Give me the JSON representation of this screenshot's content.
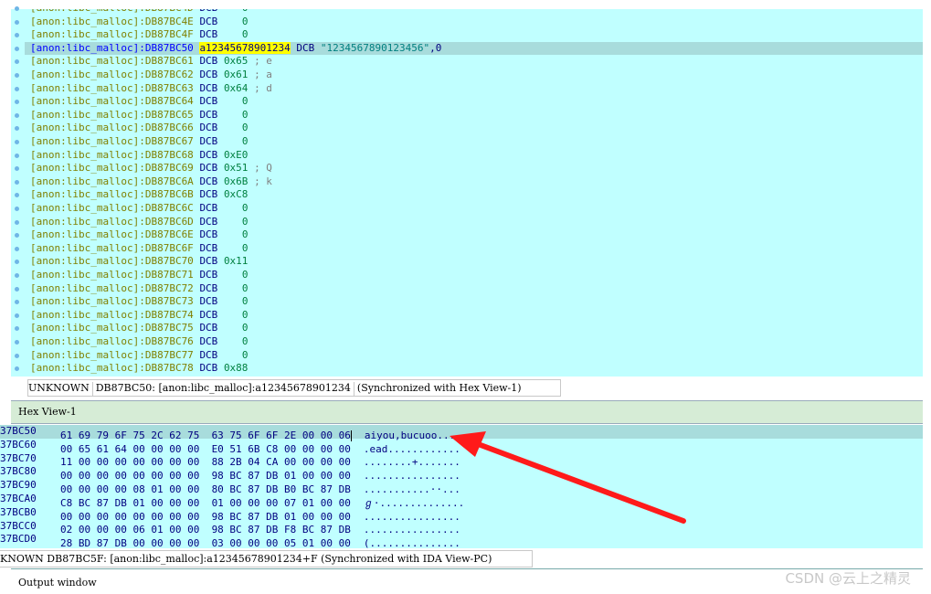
{
  "ida_view": {
    "lines": [
      {
        "seg": "[anon:libc_malloc]:DB87BC4D",
        "kw": "DCB",
        "val": "0",
        "cmt": ""
      },
      {
        "seg": "[anon:libc_malloc]:DB87BC4E",
        "kw": "DCB",
        "val": "0",
        "cmt": ""
      },
      {
        "seg": "[anon:libc_malloc]:DB87BC4F",
        "kw": "DCB",
        "val": "0",
        "cmt": ""
      },
      {
        "seg": "[anon:libc_malloc]:DB87BC50",
        "label": "a12345678901234",
        "kw": "DCB",
        "str": "\"1234567890123456\"",
        "tail": ",0",
        "selected": true
      },
      {
        "seg": "[anon:libc_malloc]:DB87BC61",
        "kw": "DCB",
        "val": "0x65",
        "cmt": "; e"
      },
      {
        "seg": "[anon:libc_malloc]:DB87BC62",
        "kw": "DCB",
        "val": "0x61",
        "cmt": "; a"
      },
      {
        "seg": "[anon:libc_malloc]:DB87BC63",
        "kw": "DCB",
        "val": "0x64",
        "cmt": "; d"
      },
      {
        "seg": "[anon:libc_malloc]:DB87BC64",
        "kw": "DCB",
        "val": "0",
        "cmt": ""
      },
      {
        "seg": "[anon:libc_malloc]:DB87BC65",
        "kw": "DCB",
        "val": "0",
        "cmt": ""
      },
      {
        "seg": "[anon:libc_malloc]:DB87BC66",
        "kw": "DCB",
        "val": "0",
        "cmt": ""
      },
      {
        "seg": "[anon:libc_malloc]:DB87BC67",
        "kw": "DCB",
        "val": "0",
        "cmt": ""
      },
      {
        "seg": "[anon:libc_malloc]:DB87BC68",
        "kw": "DCB",
        "val": "0xE0",
        "cmt": ""
      },
      {
        "seg": "[anon:libc_malloc]:DB87BC69",
        "kw": "DCB",
        "val": "0x51",
        "cmt": "; Q"
      },
      {
        "seg": "[anon:libc_malloc]:DB87BC6A",
        "kw": "DCB",
        "val": "0x6B",
        "cmt": "; k"
      },
      {
        "seg": "[anon:libc_malloc]:DB87BC6B",
        "kw": "DCB",
        "val": "0xC8",
        "cmt": ""
      },
      {
        "seg": "[anon:libc_malloc]:DB87BC6C",
        "kw": "DCB",
        "val": "0",
        "cmt": ""
      },
      {
        "seg": "[anon:libc_malloc]:DB87BC6D",
        "kw": "DCB",
        "val": "0",
        "cmt": ""
      },
      {
        "seg": "[anon:libc_malloc]:DB87BC6E",
        "kw": "DCB",
        "val": "0",
        "cmt": ""
      },
      {
        "seg": "[anon:libc_malloc]:DB87BC6F",
        "kw": "DCB",
        "val": "0",
        "cmt": ""
      },
      {
        "seg": "[anon:libc_malloc]:DB87BC70",
        "kw": "DCB",
        "val": "0x11",
        "cmt": ""
      },
      {
        "seg": "[anon:libc_malloc]:DB87BC71",
        "kw": "DCB",
        "val": "0",
        "cmt": ""
      },
      {
        "seg": "[anon:libc_malloc]:DB87BC72",
        "kw": "DCB",
        "val": "0",
        "cmt": ""
      },
      {
        "seg": "[anon:libc_malloc]:DB87BC73",
        "kw": "DCB",
        "val": "0",
        "cmt": ""
      },
      {
        "seg": "[anon:libc_malloc]:DB87BC74",
        "kw": "DCB",
        "val": "0",
        "cmt": ""
      },
      {
        "seg": "[anon:libc_malloc]:DB87BC75",
        "kw": "DCB",
        "val": "0",
        "cmt": ""
      },
      {
        "seg": "[anon:libc_malloc]:DB87BC76",
        "kw": "DCB",
        "val": "0",
        "cmt": ""
      },
      {
        "seg": "[anon:libc_malloc]:DB87BC77",
        "kw": "DCB",
        "val": "0",
        "cmt": ""
      },
      {
        "seg": "[anon:libc_malloc]:DB87BC78",
        "kw": "DCB",
        "val": "0x88",
        "cmt": ""
      }
    ],
    "status_prefix": "UNKNOWN",
    "status_text": "DB87BC50: [anon:libc_malloc]:a12345678901234",
    "status_sync": "(Synchronized with Hex View-1)"
  },
  "hex_view": {
    "title": "Hex View-1",
    "rows": [
      {
        "addr": "37BC50",
        "bytes": "61 69 79 6F 75 2C 62 75  63 75 6F 6F 2E 00 00 06",
        "ascii": "aiyou,bucuoo....",
        "selected": true
      },
      {
        "addr": "37BC60",
        "bytes": "00 65 61 64 00 00 00 00  E0 51 6B C8 00 00 00 00",
        "ascii": ".ead............"
      },
      {
        "addr": "37BC70",
        "bytes": "11 00 00 00 00 00 00 00  88 2B 04 CA 00 00 00 00",
        "ascii": "........+......."
      },
      {
        "addr": "37BC80",
        "bytes": "00 00 00 00 00 00 00 00  98 BC 87 DB 01 00 00 00",
        "ascii": "................"
      },
      {
        "addr": "37BC90",
        "bytes": "00 00 00 00 08 01 00 00  80 BC 87 DB B0 BC 87 DB",
        "ascii": "...........··..."
      },
      {
        "addr": "37BCA0",
        "bytes": "C8 BC 87 DB 01 00 00 00  01 00 00 00 07 01 00 00",
        "ascii": "ℊ·.............."
      },
      {
        "addr": "37BCB0",
        "bytes": "00 00 00 00 00 00 00 00  98 BC 87 DB 01 00 00 00",
        "ascii": "................"
      },
      {
        "addr": "37BCC0",
        "bytes": "02 00 00 00 06 01 00 00  98 BC 87 DB F8 BC 87 DB",
        "ascii": "................"
      },
      {
        "addr": "37BCD0",
        "bytes": "28 BD 87 DB 00 00 00 00  03 00 00 00 05 01 00 00",
        "ascii": "(..............."
      }
    ],
    "status_text": "KNOWN DB87BC5F: [anon:libc_malloc]:a12345678901234+F (Synchronized with IDA View-PC)"
  },
  "output_window": {
    "title": "Output window"
  },
  "watermark": "CSDN @云上之精灵",
  "colors": {
    "view_bg": "#c0ffff",
    "selection": "#a8dcdc",
    "arrow": "#ff0000"
  }
}
